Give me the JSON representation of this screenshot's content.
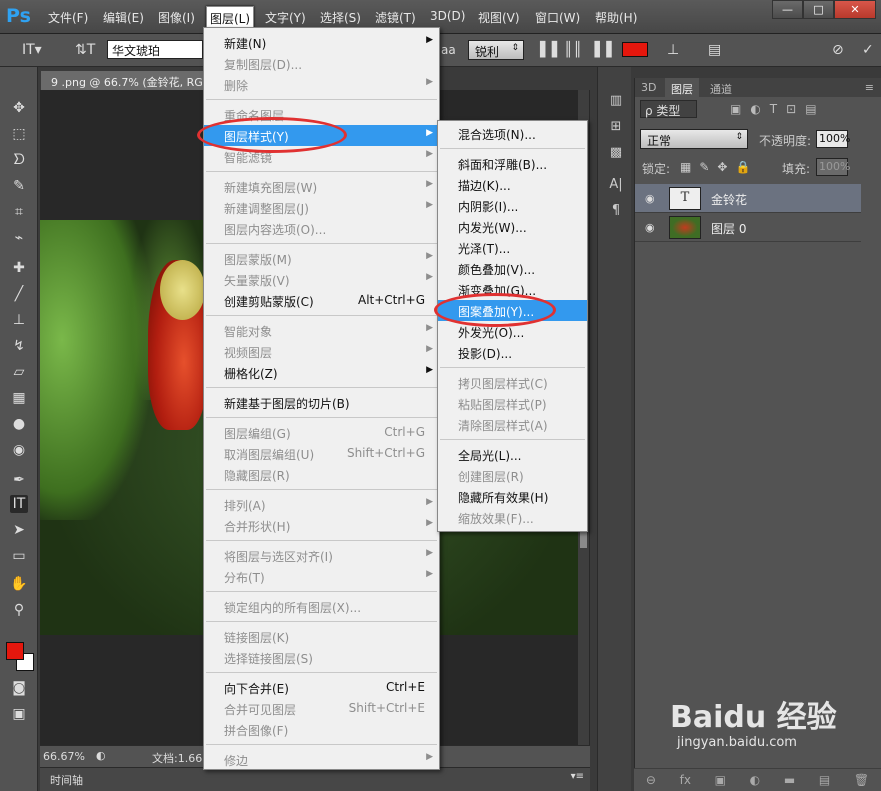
{
  "app": {
    "logo": "Ps"
  },
  "menubar": [
    "文件(F)",
    "编辑(E)",
    "图像(I)",
    "图层(L)",
    "文字(Y)",
    "选择(S)",
    "滤镜(T)",
    "3D(D)",
    "视图(V)",
    "窗口(W)",
    "帮助(H)"
  ],
  "window_buttons": [
    "—",
    "□",
    "✕"
  ],
  "options": {
    "font_family": "华文琥珀",
    "aa_label": "aa",
    "antialias": "锐利",
    "text_color": "#e5170d"
  },
  "document": {
    "tab_title": "9 .png @ 66.7% (金铃花, RGB/8)",
    "zoom": "66.67%",
    "doc_info": "文档:1.66"
  },
  "timeline": {
    "label": "时间轴"
  },
  "layers_panel": {
    "tabs": [
      "3D",
      "图层",
      "通道"
    ],
    "filter_label": "ρ 类型",
    "blend_mode": "正常",
    "opacity_label": "不透明度:",
    "opacity_value": "100%",
    "lock_label": "锁定:",
    "fill_label": "填充:",
    "fill_value": "100%",
    "layers": [
      {
        "name": "金铃花",
        "type": "text",
        "selected": true
      },
      {
        "name": "图层 0",
        "type": "image",
        "selected": false
      }
    ],
    "footer_icons": [
      "link-icon",
      "fx-icon",
      "mask-icon",
      "adjustment-icon",
      "group-icon",
      "new-layer-icon",
      "trash-icon"
    ]
  },
  "layer_menu": {
    "items": [
      {
        "label": "新建(N)",
        "sc": "",
        "sub": true,
        "dis": false
      },
      {
        "label": "复制图层(D)...",
        "sc": "",
        "sub": false,
        "dis": true
      },
      {
        "label": "删除",
        "sc": "",
        "sub": true,
        "dis": true
      },
      {
        "sep": true
      },
      {
        "label": "重命名图层...",
        "sc": "",
        "sub": false,
        "dis": true
      },
      {
        "label": "图层样式(Y)",
        "sc": "",
        "sub": true,
        "dis": false,
        "hl": true
      },
      {
        "label": "智能滤镜",
        "sc": "",
        "sub": true,
        "dis": true
      },
      {
        "sep": true
      },
      {
        "label": "新建填充图层(W)",
        "sc": "",
        "sub": true,
        "dis": true
      },
      {
        "label": "新建调整图层(J)",
        "sc": "",
        "sub": true,
        "dis": true
      },
      {
        "label": "图层内容选项(O)...",
        "sc": "",
        "sub": false,
        "dis": true
      },
      {
        "sep": true
      },
      {
        "label": "图层蒙版(M)",
        "sc": "",
        "sub": true,
        "dis": true
      },
      {
        "label": "矢量蒙版(V)",
        "sc": "",
        "sub": true,
        "dis": true
      },
      {
        "label": "创建剪贴蒙版(C)",
        "sc": "Alt+Ctrl+G",
        "sub": false,
        "dis": false
      },
      {
        "sep": true
      },
      {
        "label": "智能对象",
        "sc": "",
        "sub": true,
        "dis": true
      },
      {
        "label": "视频图层",
        "sc": "",
        "sub": true,
        "dis": true
      },
      {
        "label": "栅格化(Z)",
        "sc": "",
        "sub": true,
        "dis": false
      },
      {
        "sep": true
      },
      {
        "label": "新建基于图层的切片(B)",
        "sc": "",
        "sub": false,
        "dis": false
      },
      {
        "sep": true
      },
      {
        "label": "图层编组(G)",
        "sc": "Ctrl+G",
        "sub": false,
        "dis": true
      },
      {
        "label": "取消图层编组(U)",
        "sc": "Shift+Ctrl+G",
        "sub": false,
        "dis": true
      },
      {
        "label": "隐藏图层(R)",
        "sc": "",
        "sub": false,
        "dis": true
      },
      {
        "sep": true
      },
      {
        "label": "排列(A)",
        "sc": "",
        "sub": true,
        "dis": true
      },
      {
        "label": "合并形状(H)",
        "sc": "",
        "sub": true,
        "dis": true
      },
      {
        "sep": true
      },
      {
        "label": "将图层与选区对齐(I)",
        "sc": "",
        "sub": true,
        "dis": true
      },
      {
        "label": "分布(T)",
        "sc": "",
        "sub": true,
        "dis": true
      },
      {
        "sep": true
      },
      {
        "label": "锁定组内的所有图层(X)...",
        "sc": "",
        "sub": false,
        "dis": true
      },
      {
        "sep": true
      },
      {
        "label": "链接图层(K)",
        "sc": "",
        "sub": false,
        "dis": true
      },
      {
        "label": "选择链接图层(S)",
        "sc": "",
        "sub": false,
        "dis": true
      },
      {
        "sep": true
      },
      {
        "label": "向下合并(E)",
        "sc": "Ctrl+E",
        "sub": false,
        "dis": false
      },
      {
        "label": "合并可见图层",
        "sc": "Shift+Ctrl+E",
        "sub": false,
        "dis": true
      },
      {
        "label": "拼合图像(F)",
        "sc": "",
        "sub": false,
        "dis": true
      },
      {
        "sep": true
      },
      {
        "label": "修边",
        "sc": "",
        "sub": true,
        "dis": true
      }
    ]
  },
  "style_submenu": {
    "items": [
      {
        "label": "混合选项(N)...",
        "dis": false
      },
      {
        "sep": true
      },
      {
        "label": "斜面和浮雕(B)...",
        "dis": false
      },
      {
        "label": "描边(K)...",
        "dis": false
      },
      {
        "label": "内阴影(I)...",
        "dis": false
      },
      {
        "label": "内发光(W)...",
        "dis": false
      },
      {
        "label": "光泽(T)...",
        "dis": false
      },
      {
        "label": "颜色叠加(V)...",
        "dis": false
      },
      {
        "label": "渐变叠加(G)...",
        "dis": false
      },
      {
        "label": "图案叠加(Y)...",
        "dis": false,
        "hl": true
      },
      {
        "label": "外发光(O)...",
        "dis": false
      },
      {
        "label": "投影(D)...",
        "dis": false
      },
      {
        "sep": true
      },
      {
        "label": "拷贝图层样式(C)",
        "dis": true
      },
      {
        "label": "粘贴图层样式(P)",
        "dis": true
      },
      {
        "label": "清除图层样式(A)",
        "dis": true
      },
      {
        "sep": true
      },
      {
        "label": "全局光(L)...",
        "dis": false
      },
      {
        "label": "创建图层(R)",
        "dis": true
      },
      {
        "label": "隐藏所有效果(H)",
        "dis": false
      },
      {
        "label": "缩放效果(F)...",
        "dis": true
      }
    ]
  },
  "watermark": {
    "text": "Baidu 经验",
    "url": "jingyan.baidu.com"
  },
  "annotation_color": "#e03131"
}
